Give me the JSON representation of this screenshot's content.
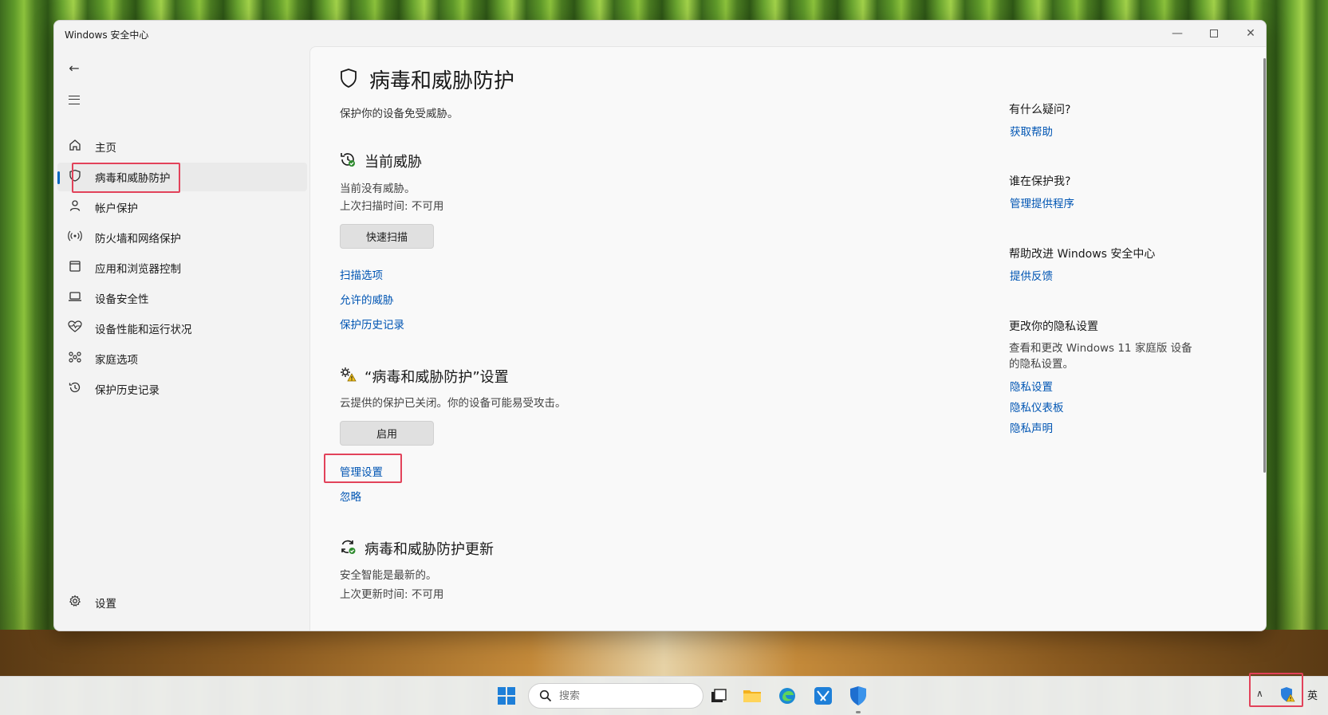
{
  "window": {
    "title": "Windows 安全中心"
  },
  "sidebar": {
    "items": [
      {
        "label": "主页",
        "icon": "home-icon"
      },
      {
        "label": "病毒和威胁防护",
        "icon": "shield-icon"
      },
      {
        "label": "帐户保护",
        "icon": "person-icon"
      },
      {
        "label": "防火墙和网络保护",
        "icon": "wifi-antenna-icon"
      },
      {
        "label": "应用和浏览器控制",
        "icon": "app-window-icon"
      },
      {
        "label": "设备安全性",
        "icon": "laptop-icon"
      },
      {
        "label": "设备性能和运行状况",
        "icon": "heart-pulse-icon"
      },
      {
        "label": "家庭选项",
        "icon": "family-icon"
      },
      {
        "label": "保护历史记录",
        "icon": "history-icon"
      }
    ],
    "settings_label": "设置"
  },
  "main": {
    "title": "病毒和威胁防护",
    "subtitle": "保护你的设备免受威胁。",
    "current_threats": {
      "title": "当前威胁",
      "line1": "当前没有威胁。",
      "line2": "上次扫描时间: 不可用",
      "scan_button": "快速扫描",
      "links": [
        "扫描选项",
        "允许的威胁",
        "保护历史记录"
      ]
    },
    "settings_section": {
      "title": "“病毒和威胁防护”设置",
      "line1": "云提供的保护已关闭。你的设备可能易受攻击。",
      "enable_button": "启用",
      "manage_link": "管理设置",
      "ignore_link": "忽略"
    },
    "updates": {
      "title": "病毒和威胁防护更新",
      "line1": "安全智能是最新的。",
      "line2": "上次更新时间: 不可用"
    }
  },
  "right": {
    "q1": "有什么疑问?",
    "q1_link": "获取帮助",
    "q2": "谁在保护我?",
    "q2_link": "管理提供程序",
    "q3": "帮助改进 Windows 安全中心",
    "q3_link": "提供反馈",
    "q4": "更改你的隐私设置",
    "q4_text": "查看和更改 Windows 11 家庭版 设备的隐私设置。",
    "q4_links": [
      "隐私设置",
      "隐私仪表板",
      "隐私声明"
    ]
  },
  "taskbar": {
    "search_placeholder": "搜索",
    "lang": "英"
  },
  "colors": {
    "accent": "#0067c0",
    "link": "#0055b3",
    "highlight": "#e2425a"
  }
}
